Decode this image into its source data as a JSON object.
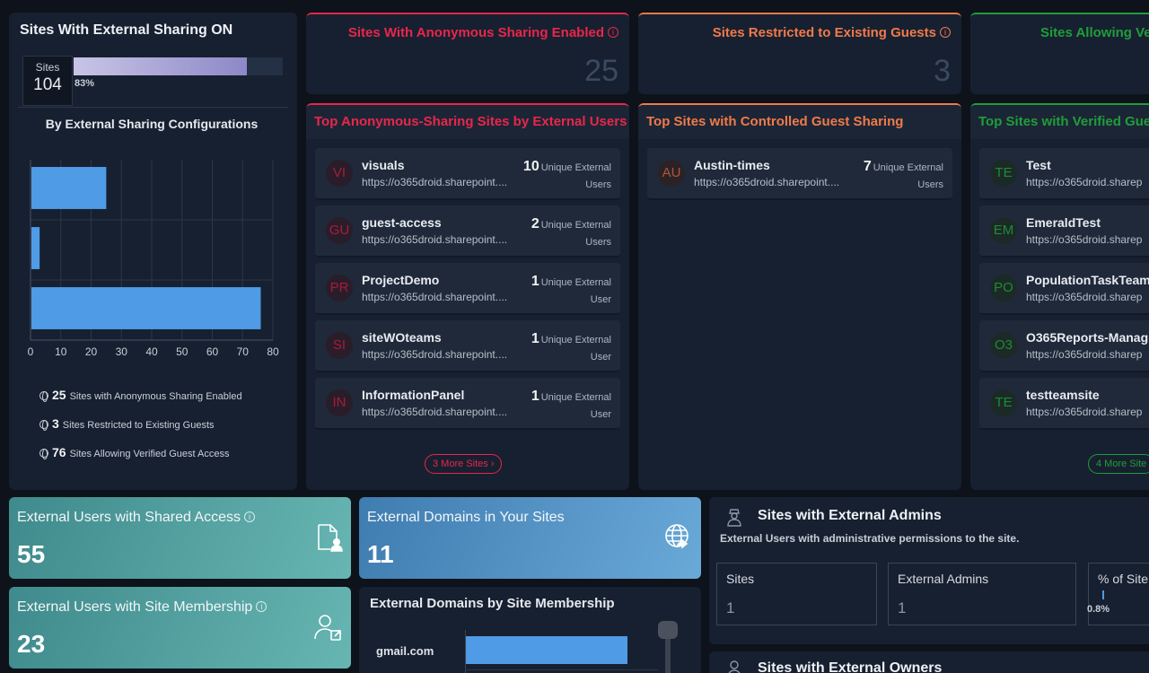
{
  "summary": {
    "title": "Sites With External Sharing ON",
    "sites_label": "Sites",
    "sites_value": "104",
    "percent_label": "83%",
    "percent": 83,
    "chart_title": "By External Sharing Configurations",
    "legend": [
      {
        "value": "25",
        "label": "Sites with Anonymous Sharing Enabled"
      },
      {
        "value": "3",
        "label": "Sites Restricted to Existing Guests"
      },
      {
        "value": "76",
        "label": "Sites Allowing Verified Guest Access"
      }
    ]
  },
  "chart_data": {
    "type": "bar",
    "orientation": "horizontal",
    "values": [
      25,
      3,
      76
    ],
    "xlim": [
      0,
      80
    ],
    "xticks": [
      "0",
      "10",
      "20",
      "30",
      "40",
      "50",
      "60",
      "70",
      "80"
    ],
    "grid": true
  },
  "stats": {
    "anonymous": {
      "title": "Sites With Anonymous Sharing Enabled",
      "value": "25"
    },
    "restricted": {
      "title": "Sites Restricted to Existing Guests",
      "value": "3"
    },
    "verified": {
      "title": "Sites Allowing Ve",
      "value": ""
    }
  },
  "anon_list": {
    "title": "Top Anonymous-Sharing Sites by External Users",
    "more": "3 More Sites",
    "items": [
      {
        "initials": "VI",
        "name": "visuals",
        "url": "https://o365droid.sharepoint....",
        "count": "10",
        "unit": "Unique External Users"
      },
      {
        "initials": "GU",
        "name": "guest-access",
        "url": "https://o365droid.sharepoint....",
        "count": "2",
        "unit": "Unique External Users"
      },
      {
        "initials": "PR",
        "name": "ProjectDemo",
        "url": "https://o365droid.sharepoint....",
        "count": "1",
        "unit": "Unique External User"
      },
      {
        "initials": "SI",
        "name": "siteWOteams",
        "url": "https://o365droid.sharepoint....",
        "count": "1",
        "unit": "Unique External User"
      },
      {
        "initials": "IN",
        "name": "InformationPanel",
        "url": "https://o365droid.sharepoint....",
        "count": "1",
        "unit": "Unique External User"
      }
    ]
  },
  "guest_list": {
    "title": "Top Sites with Controlled Guest Sharing",
    "items": [
      {
        "initials": "AU",
        "name": "Austin-times",
        "url": "https://o365droid.sharepoint....",
        "count": "7",
        "unit": "Unique External Users"
      }
    ]
  },
  "verified_list": {
    "title": "Top Sites with Verified Gues",
    "more": "4 More Site",
    "items": [
      {
        "initials": "TE",
        "name": "Test",
        "url": "https://o365droid.sharep"
      },
      {
        "initials": "EM",
        "name": "EmeraldTest",
        "url": "https://o365droid.sharep"
      },
      {
        "initials": "PO",
        "name": "PopulationTaskTeam",
        "url": "https://o365droid.sharep"
      },
      {
        "initials": "O3",
        "name": "O365Reports-Manag",
        "url": "https://o365droid.sharep"
      },
      {
        "initials": "TE",
        "name": "testteamsite",
        "url": "https://o365droid.sharep"
      }
    ]
  },
  "cards": {
    "shared_access": {
      "title": "External Users with Shared Access",
      "value": "55"
    },
    "domains": {
      "title": "External Domains in Your Sites",
      "value": "11"
    },
    "membership": {
      "title": "External Users with Site Membership",
      "value": "23"
    }
  },
  "domains_chart": {
    "title": "External Domains by Site Membership",
    "first_label": "gmail.com"
  },
  "admins": {
    "title": "Sites with External Admins",
    "subtitle": "External Users with administrative permissions to the site.",
    "boxes": [
      {
        "label": "Sites",
        "value": "1"
      },
      {
        "label": "External Admins",
        "value": "1"
      },
      {
        "label": "% of Site",
        "value": "0.8%"
      }
    ]
  },
  "owners": {
    "title": "Sites with External Owners"
  },
  "colors": {
    "anonymous": "#e8264b",
    "restricted": "#f07a4a",
    "verified": "#1f9e3a",
    "bar": "#4f9be6"
  }
}
